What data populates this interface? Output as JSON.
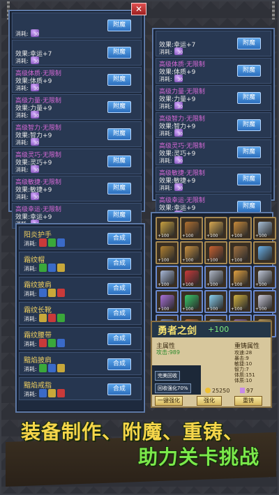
{
  "top_close": "✕",
  "enchant_left": {
    "rows": [
      {
        "title": "",
        "effect": "",
        "cost": "消耗:",
        "gem": "30",
        "btn": "附魔"
      },
      {
        "title": "",
        "effect": "效果:幸运+7",
        "cost": "消耗:",
        "gem": "30",
        "btn": "附魔"
      },
      {
        "title": "高级体质·无限制",
        "effect": "效果:体质+9",
        "cost": "消耗:",
        "gem": "30",
        "btn": "附魔"
      },
      {
        "title": "高级力量·无限制",
        "effect": "效果:力量+9",
        "cost": "消耗:",
        "gem": "30",
        "btn": "附魔"
      },
      {
        "title": "高级智力·无限制",
        "effect": "效果:智力+9",
        "cost": "消耗:",
        "gem": "30",
        "btn": "附魔"
      },
      {
        "title": "高级灵巧·无限制",
        "effect": "效果:灵巧+9",
        "cost": "消耗:",
        "gem": "30",
        "btn": "附魔"
      },
      {
        "title": "高级敏捷·无限制",
        "effect": "效果:敏捷+9",
        "cost": "消耗:",
        "gem": "30",
        "btn": "附魔"
      },
      {
        "title": "高级幸运·无限制",
        "effect": "效果:幸运+9",
        "cost": "消耗:",
        "gem": "30",
        "btn": "附魔"
      }
    ]
  },
  "enchant_right": {
    "rows": [
      {
        "title": "",
        "effect": "效果:幸运+7",
        "cost": "消耗:",
        "gem": "30",
        "btn": "附魔"
      },
      {
        "title": "高级体质·无限制",
        "effect": "效果:体质+9",
        "cost": "消耗:",
        "gem": "30",
        "btn": "附魔"
      },
      {
        "title": "高级力量·无限制",
        "effect": "效果:力量+9",
        "cost": "消耗:",
        "gem": "30",
        "btn": "附魔"
      },
      {
        "title": "高级智力·无限制",
        "effect": "效果:智力+9",
        "cost": "消耗:",
        "gem": "30",
        "btn": "附魔"
      },
      {
        "title": "高级灵巧·无限制",
        "effect": "效果:灵巧+9",
        "cost": "消耗:",
        "gem": "30",
        "btn": "附魔"
      },
      {
        "title": "高级敏捷·无限制",
        "effect": "效果:敏捷+9",
        "cost": "消耗:",
        "gem": "30",
        "btn": "附魔"
      },
      {
        "title": "高级幸运·无限制",
        "effect": "效果:幸运+9",
        "cost": "消耗:",
        "gem": "30",
        "btn": "附魔"
      }
    ]
  },
  "craft": {
    "rows": [
      {
        "name": "阳炎护手",
        "cost": "消耗:",
        "btn": "合成"
      },
      {
        "name": "霜纹帽",
        "cost": "消耗:",
        "btn": "合成"
      },
      {
        "name": "霜纹披肩",
        "cost": "消耗:",
        "btn": "合成"
      },
      {
        "name": "霜纹长靴",
        "cost": "消耗:",
        "btn": "合成"
      },
      {
        "name": "霜纹腰带",
        "cost": "消耗:",
        "btn": "合成"
      },
      {
        "name": "黯焰披肩",
        "cost": "消耗:",
        "btn": "合成"
      },
      {
        "name": "黯焰戒指",
        "cost": "消耗:",
        "btn": "合成"
      }
    ]
  },
  "inventory": {
    "tags": [
      "+100",
      "+100",
      "+100",
      "+100",
      "+100",
      "+100",
      "+100",
      "+100",
      "+100",
      "",
      "+100",
      "+100",
      "+100",
      "+100",
      "+100",
      "+100",
      "+100",
      "+100",
      "+100",
      "+100",
      "+100",
      "+100",
      "+100",
      "+100",
      "+100"
    ]
  },
  "detail": {
    "name": "勇者之剑",
    "plus": "+100",
    "main_attr": "主属性",
    "atk": "攻击:989",
    "recast": "重铸属性",
    "stats": [
      "攻速:28",
      "暴击:9",
      "敏捷:10",
      "智力:7",
      "体质:151",
      "体质:10"
    ],
    "btn_equip": "完美回收",
    "btn_recycle": "回收强化70%",
    "btn_onekey": "一键强化",
    "btn_strengthen": "强化",
    "btn_recast": "重铸",
    "gold": "25250",
    "gem": "97"
  },
  "banner": {
    "line1": "装备制作、附魔、重铸、",
    "line2": "助力关卡挑战"
  },
  "colors": {
    "accent_blue": "#2c6fbd",
    "title_purple": "#d86ad8",
    "gold_text": "#f6d64a",
    "green_text": "#7be94a"
  }
}
